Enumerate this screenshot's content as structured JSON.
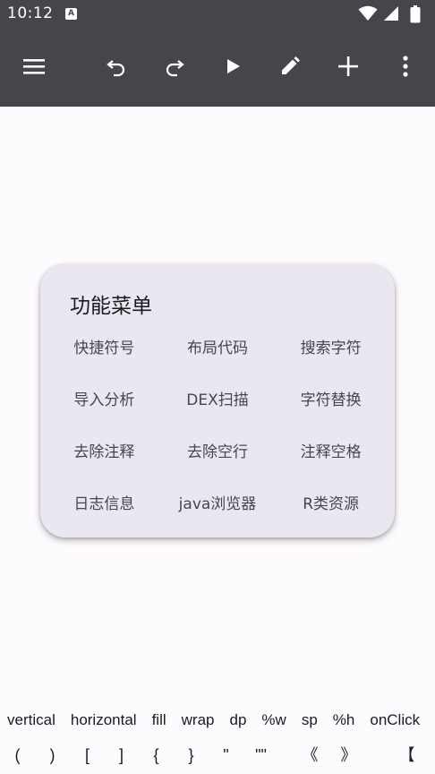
{
  "status": {
    "time": "10:12",
    "notification_letter": "A",
    "icons": [
      "wifi-icon",
      "signal-icon",
      "battery-icon"
    ]
  },
  "toolbar": {
    "buttons": [
      "menu-icon",
      "undo-icon",
      "redo-icon",
      "play-icon",
      "edit-icon",
      "add-icon",
      "more-vert-icon"
    ],
    "icon_color": "#ffffff",
    "background": "#47454c"
  },
  "menu": {
    "title": "功能菜单",
    "items": [
      "快捷符号",
      "布局代码",
      "搜索字符",
      "导入分析",
      "DEX扫描",
      "字符替换",
      "去除注释",
      "去除空行",
      "注释空格",
      "日志信息",
      "java浏览器",
      "R类资源"
    ]
  },
  "suggestions": [
    "vertical",
    "horizontal",
    "fill",
    "wrap",
    "dp",
    "%w",
    "sp",
    "%h",
    "onClick"
  ],
  "symbols": [
    "(",
    ")",
    "[",
    "]",
    "{",
    "}",
    "\"",
    "\"\"",
    "《",
    "》",
    "【"
  ]
}
